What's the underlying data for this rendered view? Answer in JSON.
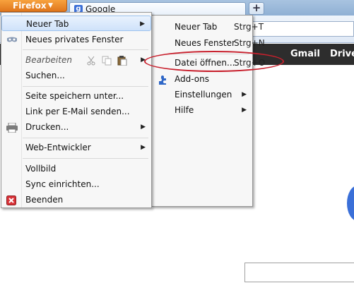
{
  "browser": {
    "app_button_label": "Firefox",
    "app_button_arrow": "▼",
    "tab_title": "Google",
    "tab_favicon_letter": "g",
    "new_tab_symbol": "+"
  },
  "google_bar": {
    "links": [
      "Gmail",
      "Drive"
    ]
  },
  "firefox_menu": {
    "items": [
      {
        "label": "Neuer Tab",
        "has_submenu": true,
        "highlighted": true
      },
      {
        "label": "Neues privates Fenster",
        "icon": "private-mask-icon"
      },
      {
        "label": "Bearbeiten",
        "disabled": true,
        "has_submenu": true,
        "icons": [
          "cut-icon",
          "copy-icon",
          "paste-icon"
        ]
      },
      {
        "label": "Suchen..."
      },
      {
        "label": "Seite speichern unter..."
      },
      {
        "label": "Link per E-Mail senden..."
      },
      {
        "label": "Drucken...",
        "icon": "printer-icon",
        "has_submenu": true
      },
      {
        "label": "Web-Entwickler",
        "has_submenu": true
      },
      {
        "label": "Vollbild"
      },
      {
        "label": "Sync einrichten..."
      },
      {
        "label": "Beenden",
        "icon": "quit-icon"
      }
    ],
    "submenu_arrow": "▶"
  },
  "right_menu": {
    "items": [
      {
        "label": "Neuer Tab",
        "shortcut": "Strg+T"
      },
      {
        "label": "Neues Fenster",
        "shortcut": "Strg+N"
      },
      {
        "label": "Datei öffnen...",
        "shortcut": "Strg+O",
        "annotated": true
      },
      {
        "label": "Add-ons",
        "icon": "puzzle-piece-icon"
      },
      {
        "label": "Einstellungen",
        "has_submenu": true
      },
      {
        "label": "Hilfe",
        "has_submenu": true
      }
    ]
  },
  "colors": {
    "firefox_orange": "#e0761c",
    "annotation_red": "#c8202d",
    "google_bar": "#2d2d2d"
  }
}
